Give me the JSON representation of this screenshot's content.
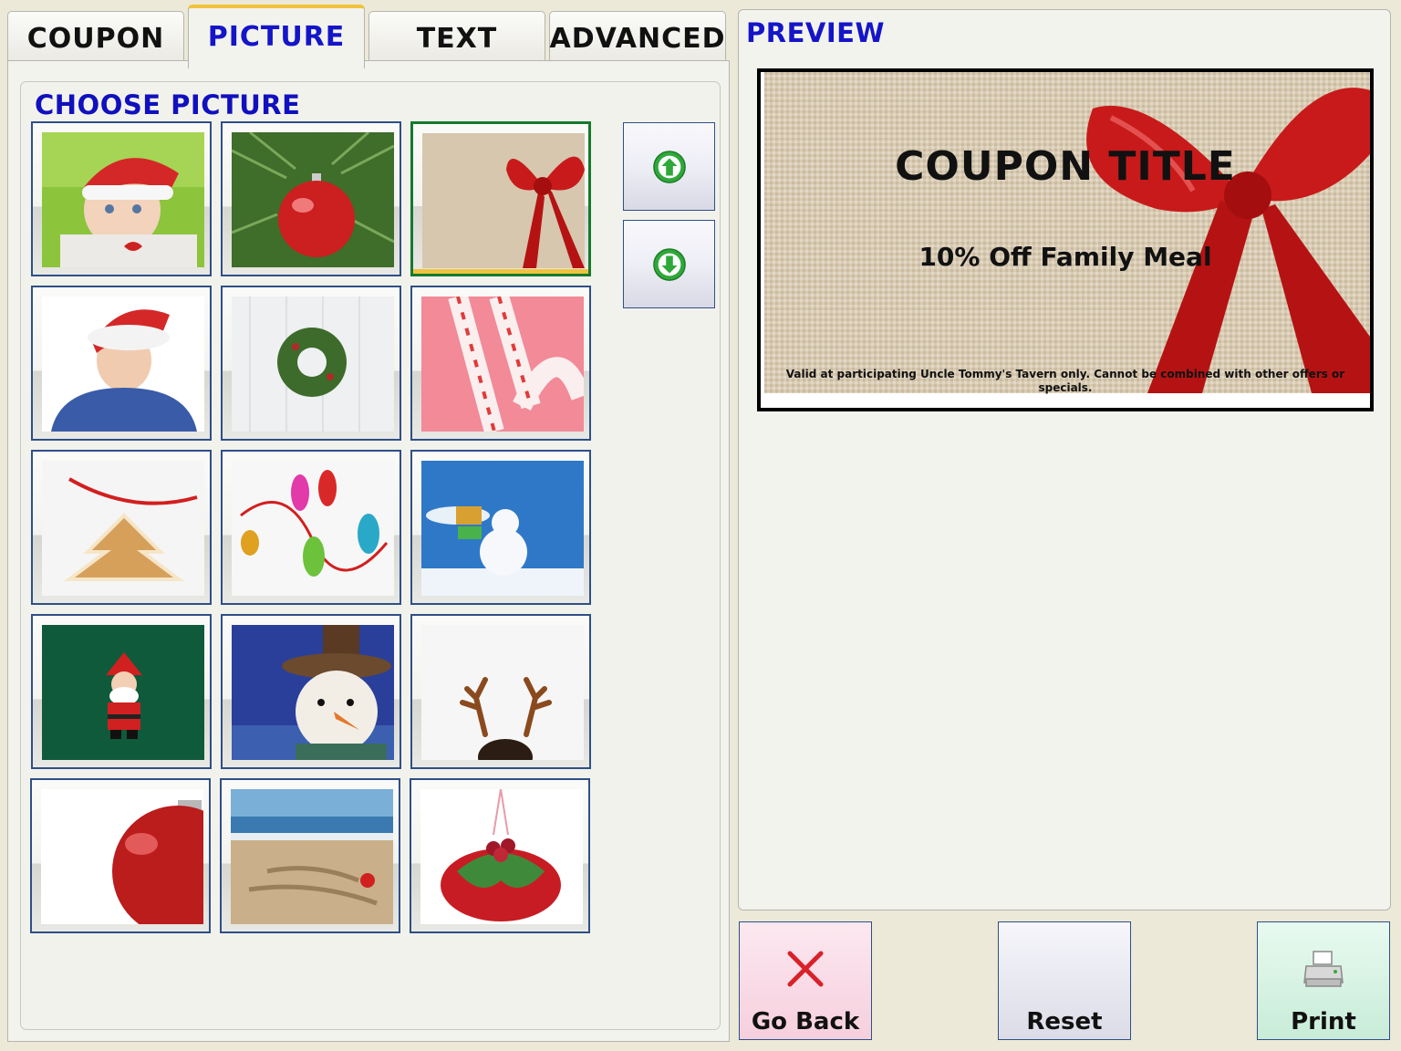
{
  "tabs": [
    {
      "label": "COUPON"
    },
    {
      "label": "PICTURE"
    },
    {
      "label": "TEXT"
    },
    {
      "label": "ADVANCED"
    }
  ],
  "active_tab": "PICTURE",
  "choose_picture": {
    "title": "CHOOSE PICTURE",
    "selected_index": 2,
    "scroll_up_icon": "arrow-up-circle-icon",
    "scroll_down_icon": "arrow-down-circle-icon"
  },
  "preview": {
    "title": "PREVIEW",
    "coupon_title": "COUPON TITLE",
    "coupon_subtitle": "10% Off Family Meal",
    "coupon_fine_print": "Valid at participating Uncle Tommy's Tavern only. Cannot be combined with other offers or specials."
  },
  "actions": {
    "go_back": "Go Back",
    "reset": "Reset",
    "print": "Print"
  },
  "colors": {
    "accent_blue": "#1515c8",
    "selected_border": "#167a2c",
    "tab_highlight": "#f0c33c"
  }
}
